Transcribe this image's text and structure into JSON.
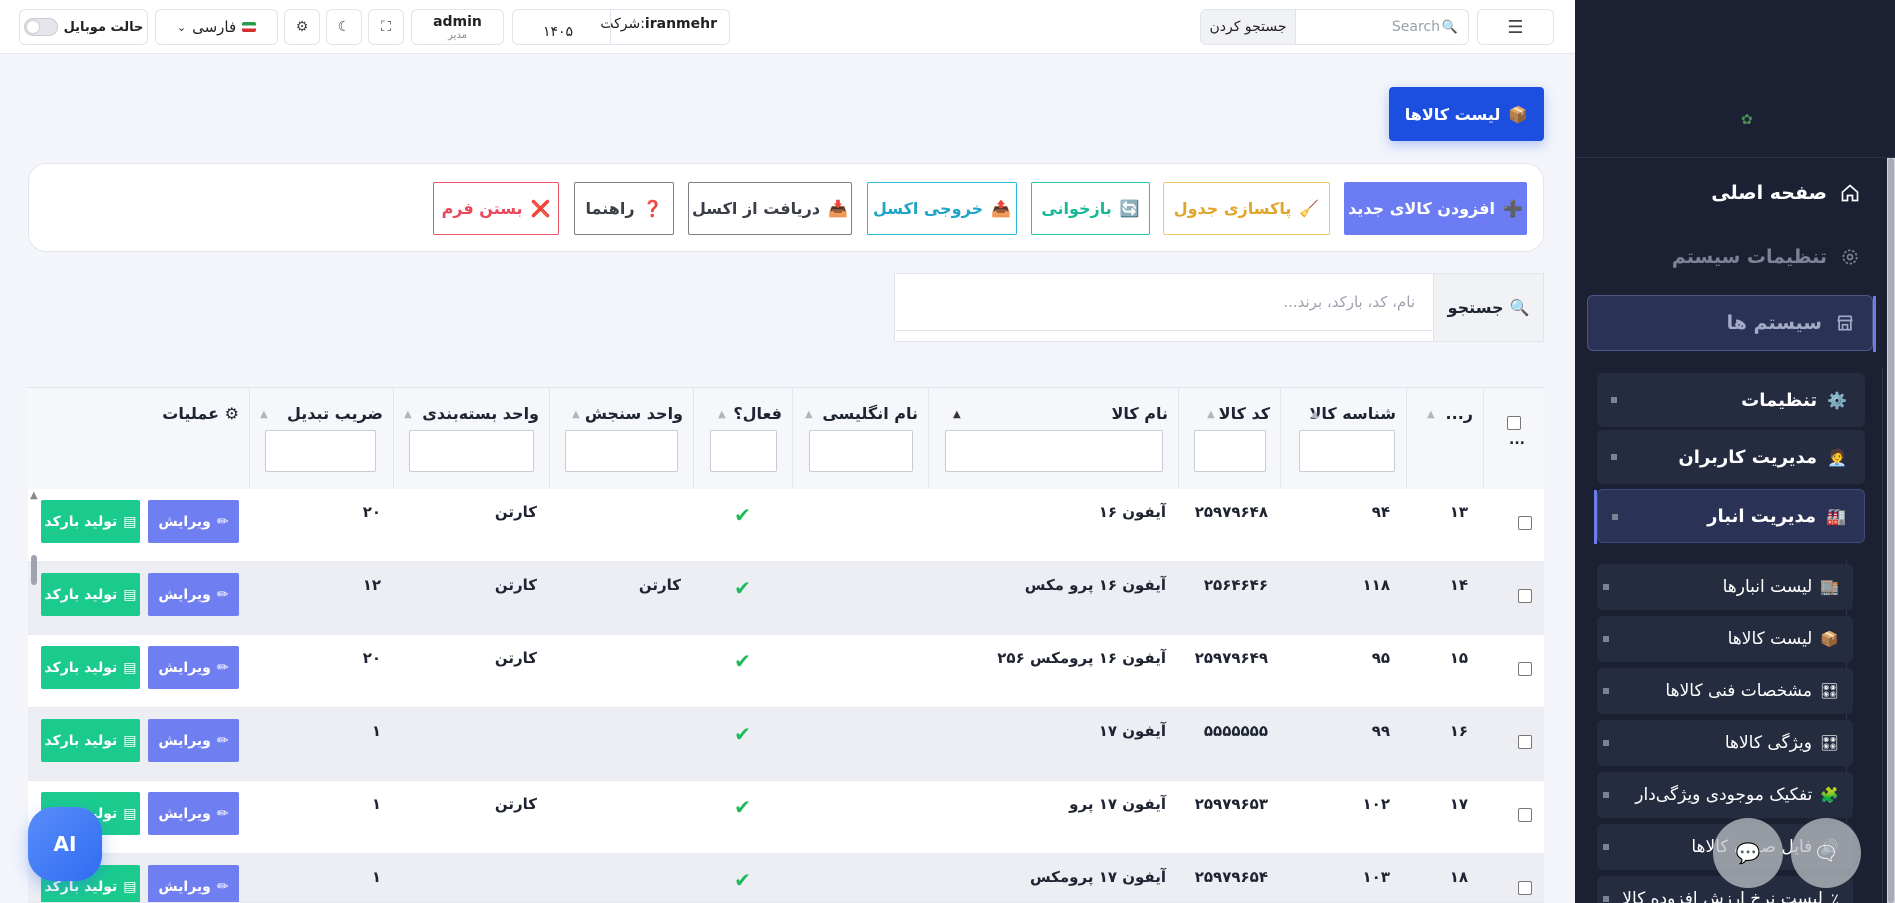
{
  "topbar": {
    "search_placeholder": "Search",
    "search_button": "جستجو کردن",
    "company_prefix": "شرکت:",
    "company_name": "iranmehr",
    "company_code": "۱۴۰۵",
    "user_name": "admin",
    "user_role": "مدیر",
    "language": "فارسی",
    "mobile_mode": "حالت موبایل"
  },
  "sidebar": {
    "home": "صفحه اصلی",
    "system_settings": "تنظیمات سیستم",
    "systems": "سیستم ها",
    "settings": "تنظیمات",
    "user_management": "مدیریت کاربران",
    "warehouse_management": "مدیریت انبار",
    "leaves": [
      {
        "label": "لیست انبارها",
        "icon": "🏬"
      },
      {
        "label": "لیست کالاها",
        "icon": "📦"
      },
      {
        "label": "مشخصات فنی کالاها",
        "icon": "🎛"
      },
      {
        "label": "ویژگی کالاها",
        "icon": "🎛"
      },
      {
        "label": "تفکیک موجودی ویژگی‌دار",
        "icon": "🧩"
      },
      {
        "label": "فایل صوتی کالاها",
        "icon": "🔊"
      },
      {
        "label": "لیست نرخ ارزش افزوده کالا",
        "icon": "٪"
      }
    ]
  },
  "page": {
    "title": "لیست کالاها"
  },
  "toolbar": {
    "add": "افزودن کالای جدید",
    "clean": "پاکسازی جدول",
    "reload": "بازخوانی",
    "export": "خروجی اکسل",
    "import": "دریافت از اکسل",
    "help": "راهنما",
    "close": "بستن فرم"
  },
  "search": {
    "label": "جستجو",
    "placeholder": "نام، کد، بارکد، برند..."
  },
  "table": {
    "headers": {
      "select_more": "...",
      "row": "ر...",
      "product_id": "شناسه کالا",
      "product_code": "کد کالا",
      "product_name": "نام کالا",
      "english_name": "نام انگلیسی",
      "active": "فعال؟",
      "unit": "واحد سنجش",
      "package_unit": "واحد بسته‌بندی",
      "factor": "ضریب تبدیل",
      "operations": "⚙ عملیات"
    },
    "edit_label": "ویرایش",
    "barcode_label": "تولید بارکد",
    "rows": [
      {
        "row": "۱۳",
        "id": "۹۴",
        "code": "۲۵۹۷۹۶۴۸",
        "name": "آیفون ۱۶",
        "en": "",
        "unit": "",
        "pkg": "کارتن",
        "factor": "۲۰"
      },
      {
        "row": "۱۴",
        "id": "۱۱۸",
        "code": "۲۵۶۴۶۴۶",
        "name": "آیفون ۱۶ پرو مکس",
        "en": "",
        "unit": "کارتن",
        "pkg": "کارتن",
        "factor": "۱۲"
      },
      {
        "row": "۱۵",
        "id": "۹۵",
        "code": "۲۵۹۷۹۶۴۹",
        "name": "آیفون ۱۶ پرومکس ۲۵۶",
        "en": "",
        "unit": "",
        "pkg": "کارتن",
        "factor": "۲۰"
      },
      {
        "row": "۱۶",
        "id": "۹۹",
        "code": "۵۵۵۵۵۵۵",
        "name": "آیفون ۱۷",
        "en": "",
        "unit": "",
        "pkg": "",
        "factor": "۱"
      },
      {
        "row": "۱۷",
        "id": "۱۰۲",
        "code": "۲۵۹۷۹۶۵۳",
        "name": "آیفون ۱۷ پرو",
        "en": "",
        "unit": "",
        "pkg": "کارتن",
        "factor": "۱"
      },
      {
        "row": "۱۸",
        "id": "۱۰۳",
        "code": "۲۵۹۷۹۶۵۴",
        "name": "آیفون ۱۷ پرومکس",
        "en": "",
        "unit": "",
        "pkg": "",
        "factor": "۱"
      }
    ]
  },
  "ai_button": "AI",
  "colors": {
    "sidebar_bg": "#1b2133",
    "primary": "#1c4fe0",
    "accent": "#6c7cf2",
    "success": "#1bcb8e"
  }
}
